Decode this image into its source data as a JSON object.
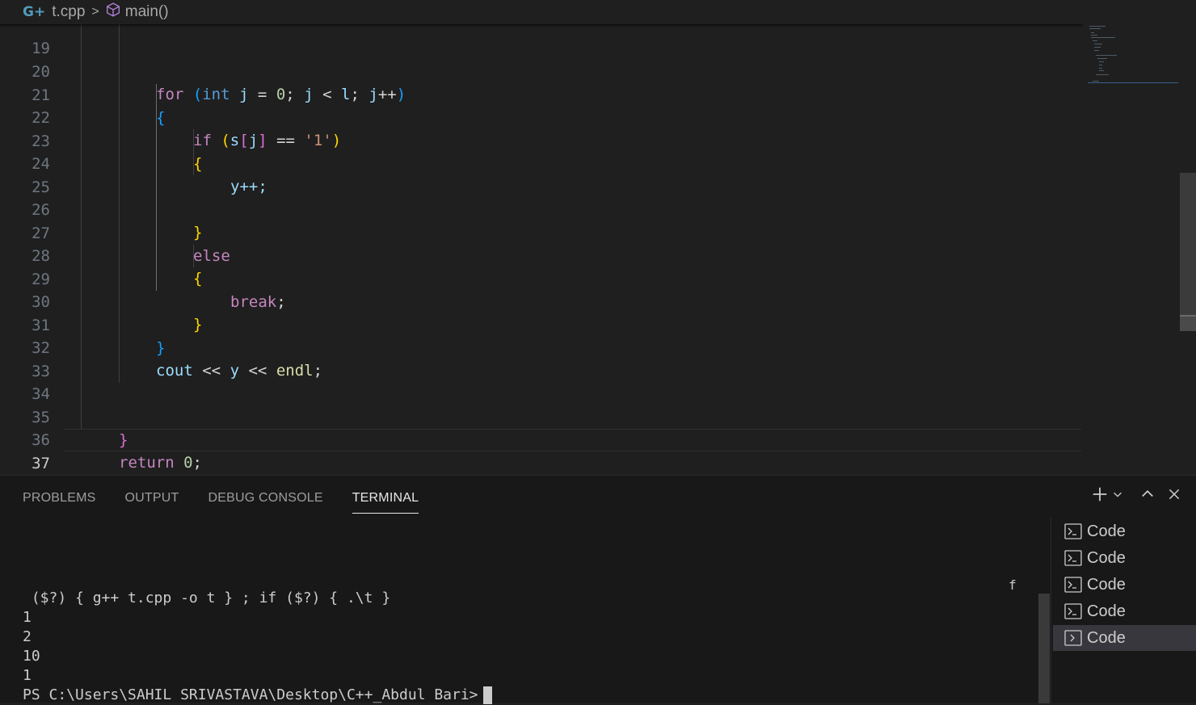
{
  "breadcrumb": {
    "icon": "c-plus-plus-file-icon",
    "file": "t.cpp",
    "symbol_icon": "cube-method-icon",
    "symbol": "main()"
  },
  "editor": {
    "lines": [
      {
        "n": "19",
        "code": ""
      },
      {
        "n": "20",
        "code": "for (int j = 0; j < l; j++)"
      },
      {
        "n": "21",
        "code": "{"
      },
      {
        "n": "22",
        "code": "if (s[j] == '1')"
      },
      {
        "n": "23",
        "code": "{"
      },
      {
        "n": "24",
        "code": "y++;"
      },
      {
        "n": "25",
        "code": ""
      },
      {
        "n": "26",
        "code": "}"
      },
      {
        "n": "27",
        "code": "else"
      },
      {
        "n": "28",
        "code": "{"
      },
      {
        "n": "29",
        "code": "break;"
      },
      {
        "n": "30",
        "code": "}"
      },
      {
        "n": "31",
        "code": "}"
      },
      {
        "n": "32",
        "code": "cout << y << endl;"
      },
      {
        "n": "33",
        "code": ""
      },
      {
        "n": "34",
        "code": ""
      },
      {
        "n": "35",
        "code": "}"
      },
      {
        "n": "36",
        "code": "return 0;"
      },
      {
        "n": "37",
        "code": "}"
      }
    ]
  },
  "panel": {
    "tabs": [
      {
        "label": "PROBLEMS"
      },
      {
        "label": "OUTPUT"
      },
      {
        "label": "DEBUG CONSOLE"
      },
      {
        "label": "TERMINAL",
        "active": true
      }
    ],
    "actions": [
      "plus-icon",
      "chevron-down-icon",
      "chevron-up-icon",
      "close-icon"
    ]
  },
  "terminal": {
    "stray_char": "f",
    "lines": [
      " ($?) { g++ t.cpp -o t } ; if ($?) { .\\t }",
      "1",
      "2",
      "10",
      "1",
      "PS C:\\Users\\SAHIL SRIVASTAVA\\Desktop\\C++_Abdul Bari>"
    ],
    "instances": [
      "Code",
      "Code",
      "Code",
      "Code",
      "Code"
    ],
    "selected_instance": 5
  }
}
